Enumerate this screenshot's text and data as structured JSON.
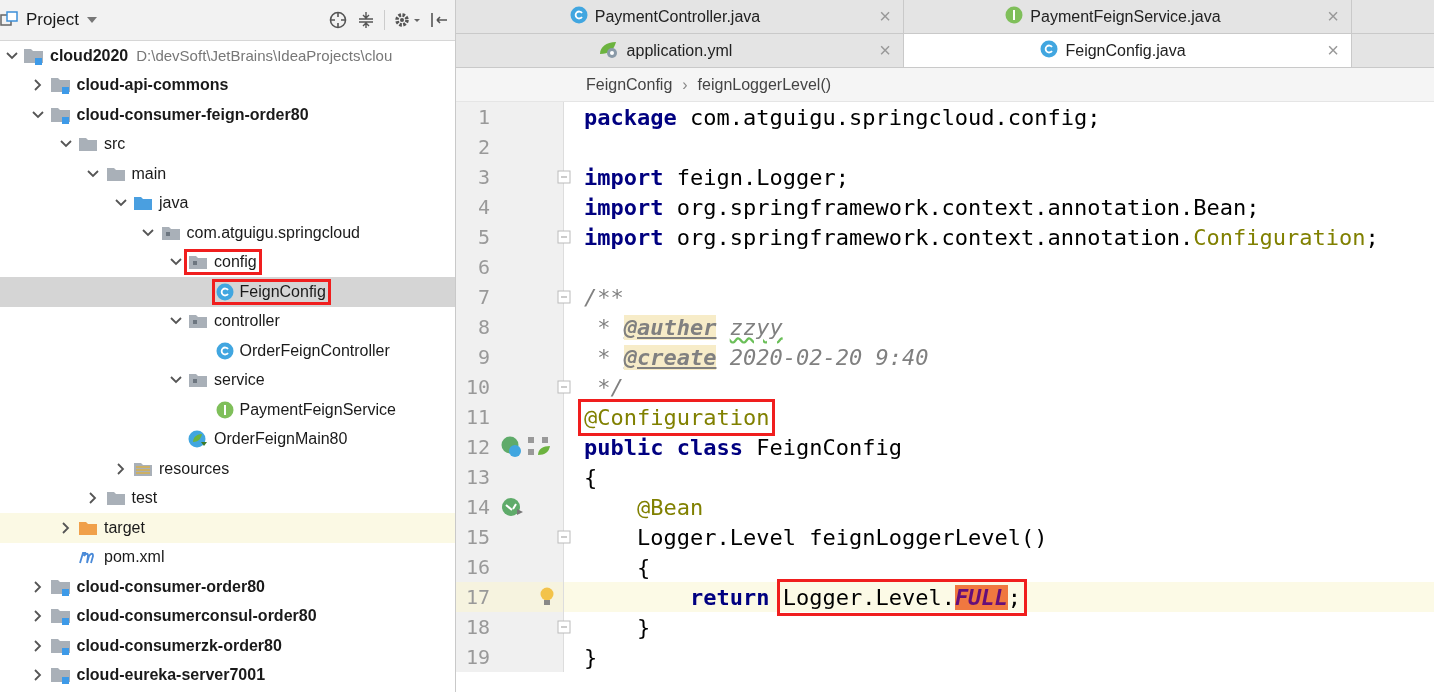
{
  "project_panel": {
    "title": "Project",
    "tree": [
      {
        "label": "cloud2020",
        "path": "D:\\devSoft\\JetBrains\\IdeaProjects\\clou",
        "kind": "module",
        "expanded": true,
        "selected": false,
        "children": [
          {
            "label": "cloud-api-commons",
            "kind": "module",
            "expanded": false,
            "selected": false
          },
          {
            "label": "cloud-consumer-feign-order80",
            "kind": "module",
            "expanded": true,
            "selected": false,
            "children": [
              {
                "label": "src",
                "kind": "folder",
                "expanded": true,
                "selected": false,
                "children": [
                  {
                    "label": "main",
                    "kind": "folder",
                    "expanded": true,
                    "selected": false,
                    "children": [
                      {
                        "label": "java",
                        "kind": "source",
                        "expanded": true,
                        "selected": false,
                        "children": [
                          {
                            "label": "com.atguigu.springcloud",
                            "kind": "package",
                            "expanded": true,
                            "selected": false,
                            "children": [
                              {
                                "label": "config",
                                "kind": "package",
                                "expanded": true,
                                "selected": false,
                                "boxed": true,
                                "children": [
                                  {
                                    "label": "FeignConfig",
                                    "kind": "class",
                                    "selected": true,
                                    "boxed": true
                                  }
                                ]
                              },
                              {
                                "label": "controller",
                                "kind": "package",
                                "expanded": true,
                                "selected": false,
                                "children": [
                                  {
                                    "label": "OrderFeignController",
                                    "kind": "class",
                                    "selected": false
                                  }
                                ]
                              },
                              {
                                "label": "service",
                                "kind": "package",
                                "expanded": true,
                                "selected": false,
                                "children": [
                                  {
                                    "label": "PaymentFeignService",
                                    "kind": "interface",
                                    "selected": false
                                  }
                                ]
                              },
                              {
                                "label": "OrderFeignMain80",
                                "kind": "boot",
                                "selected": false
                              }
                            ]
                          }
                        ]
                      },
                      {
                        "label": "resources",
                        "kind": "resources",
                        "expanded": false,
                        "selected": false
                      }
                    ]
                  },
                  {
                    "label": "test",
                    "kind": "folder",
                    "expanded": false,
                    "selected": false
                  }
                ]
              },
              {
                "label": "target",
                "kind": "excluded",
                "expanded": false,
                "selected": false,
                "highlighted": true
              },
              {
                "label": "pom.xml",
                "kind": "maven",
                "selected": false
              }
            ]
          },
          {
            "label": "cloud-consumer-order80",
            "kind": "module",
            "expanded": false,
            "selected": false
          },
          {
            "label": "cloud-consumerconsul-order80",
            "kind": "module",
            "expanded": false,
            "selected": false
          },
          {
            "label": "cloud-consumerzk-order80",
            "kind": "module",
            "expanded": false,
            "selected": false
          },
          {
            "label": "cloud-eureka-server7001",
            "kind": "module",
            "expanded": false,
            "selected": false
          }
        ]
      }
    ]
  },
  "editor": {
    "tab_rows": [
      [
        {
          "label": "PaymentController.java",
          "kind": "class",
          "selected": false
        },
        {
          "label": "PaymentFeignService.java",
          "kind": "interface",
          "selected": false
        }
      ],
      [
        {
          "label": "application.yml",
          "kind": "spring",
          "selected": false
        },
        {
          "label": "FeignConfig.java",
          "kind": "class",
          "selected": true
        }
      ]
    ],
    "close_glyph": "×",
    "breadcrumb": [
      "FeignConfig",
      "feignLoggerLevel()"
    ],
    "breadcrumb_separator": "›",
    "lines": [
      {
        "number": "1",
        "kind": "plain",
        "tokens": [
          {
            "text": "package ",
            "kind": "keyword"
          },
          {
            "text": "com.atguigu.springcloud.config;",
            "kind": "plain"
          }
        ]
      },
      {
        "number": "2",
        "kind": "plain"
      },
      {
        "number": "3",
        "kind": "plain",
        "fold": true,
        "tokens": [
          {
            "text": "import ",
            "kind": "keyword"
          },
          {
            "text": "feign.Logger;",
            "kind": "plain"
          }
        ]
      },
      {
        "number": "4",
        "kind": "plain",
        "tokens": [
          {
            "text": "import ",
            "kind": "keyword"
          },
          {
            "text": "org.springframework.context.annotation.Bean;",
            "kind": "plain"
          }
        ]
      },
      {
        "number": "5",
        "kind": "plain",
        "fold": true,
        "tokens": [
          {
            "text": "import ",
            "kind": "keyword"
          },
          {
            "text": "org.springframework.context.annotation.",
            "kind": "plain"
          },
          {
            "text": "Configuration",
            "kind": "annotation"
          },
          {
            "text": ";",
            "kind": "plain"
          }
        ]
      },
      {
        "number": "6",
        "kind": "plain"
      },
      {
        "number": "7",
        "kind": "plain",
        "fold": true,
        "tokens": [
          {
            "text": "/**",
            "kind": "comment"
          }
        ]
      },
      {
        "number": "8",
        "kind": "plain",
        "tokens": [
          {
            "text": " * ",
            "kind": "comment"
          },
          {
            "text": "@auther",
            "kind": "doctag"
          },
          {
            "text": "zzyy",
            "kind": "typo"
          }
        ]
      },
      {
        "number": "9",
        "kind": "plain",
        "tokens": [
          {
            "text": " * ",
            "kind": "comment"
          },
          {
            "text": "@create",
            "kind": "doctag"
          },
          {
            "text": " 2020-02-20 9:40",
            "kind": "comment"
          }
        ]
      },
      {
        "number": "10",
        "kind": "plain",
        "fold": true,
        "tokens": [
          {
            "text": " */",
            "kind": "comment"
          }
        ]
      },
      {
        "number": "11",
        "kind": "plain",
        "tokens": [
          {
            "text": "@Configuration",
            "kind": "annotation",
            "boxed": true
          }
        ]
      },
      {
        "number": "12",
        "kind": "bean-class",
        "tokens": [
          {
            "text": "public class ",
            "kind": "keyword"
          },
          {
            "text": "FeignConfig",
            "kind": "plain"
          }
        ]
      },
      {
        "number": "13",
        "kind": "plain",
        "tokens": [
          {
            "text": "{",
            "kind": "plain"
          }
        ]
      },
      {
        "number": "14",
        "kind": "bean",
        "tokens": [
          {
            "text": "    @Bean",
            "kind": "annotation"
          }
        ]
      },
      {
        "number": "15",
        "kind": "plain",
        "fold": true,
        "tokens": [
          {
            "text": "    Logger.Level feignLoggerLevel()",
            "kind": "plain"
          }
        ]
      },
      {
        "number": "16",
        "kind": "plain",
        "tokens": [
          {
            "text": "    {",
            "kind": "plain"
          }
        ]
      },
      {
        "number": "17",
        "kind": "bulb",
        "current": true,
        "tokens": [
          {
            "text": "        return ",
            "kind": "keyword"
          },
          {
            "text": "Logger.Level.",
            "kind": "plain",
            "boxed": true
          },
          {
            "text": "FULL",
            "kind": "constant",
            "boxed": true
          },
          {
            "text": ";",
            "kind": "plain",
            "boxed": true
          }
        ]
      },
      {
        "number": "18",
        "kind": "plain",
        "fold": true,
        "tokens": [
          {
            "text": "    }",
            "kind": "plain"
          }
        ]
      },
      {
        "number": "19",
        "kind": "plain",
        "tokens": [
          {
            "text": "}",
            "kind": "plain"
          }
        ]
      }
    ]
  }
}
